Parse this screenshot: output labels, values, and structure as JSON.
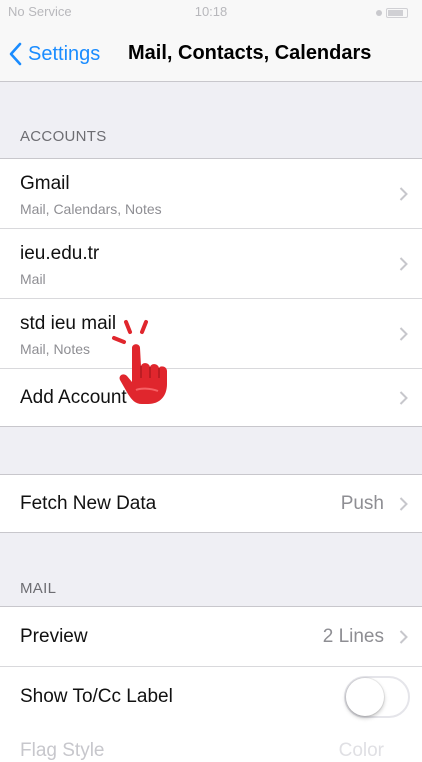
{
  "status_bar": {
    "carrier": "No Service",
    "time": "10:18"
  },
  "nav": {
    "back_label": "Settings",
    "title": "Mail, Contacts, Calendars"
  },
  "accounts": {
    "header": "ACCOUNTS",
    "items": [
      {
        "title": "Gmail",
        "subtitle": "Mail, Calendars, Notes"
      },
      {
        "title": "ieu.edu.tr",
        "subtitle": "Mail"
      },
      {
        "title": "std ieu mail",
        "subtitle": "Mail, Notes"
      }
    ],
    "add_account": "Add Account"
  },
  "fetch": {
    "label": "Fetch New Data",
    "value": "Push"
  },
  "mail": {
    "header": "MAIL",
    "preview": {
      "label": "Preview",
      "value": "2 Lines"
    },
    "show_tocc": {
      "label": "Show To/Cc Label",
      "enabled": false
    },
    "flag_style": {
      "label": "Flag Style",
      "value": "Color"
    }
  },
  "colors": {
    "accent": "#1a8cff",
    "hand": "#e0262d",
    "background": "#efeff4"
  }
}
